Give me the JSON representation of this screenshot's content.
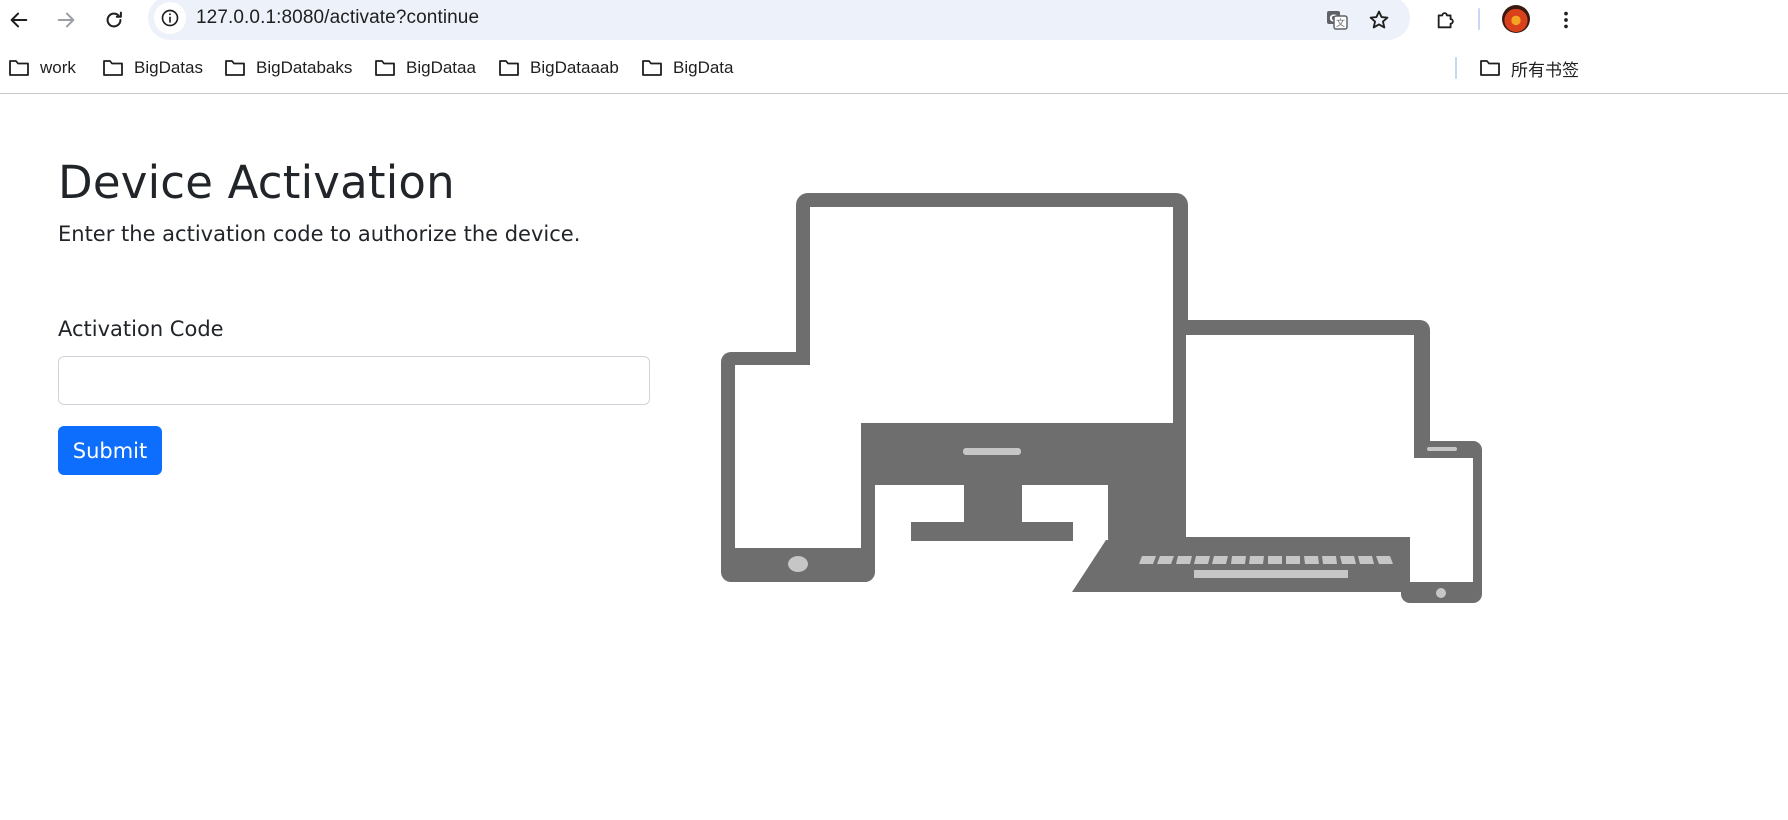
{
  "browser": {
    "url": "127.0.0.1:8080/activate?continue",
    "bookmarks": [
      "work",
      "BigDatas",
      "BigDatabaks",
      "BigDataa",
      "BigDataaab",
      "BigData"
    ],
    "all_bookmarks_label": "所有书签",
    "icons": {
      "back": "arrow-left-icon",
      "forward": "arrow-right-icon",
      "reload": "reload-icon",
      "site_info": "info-icon",
      "translate": "translate-icon",
      "bookmark": "star-icon",
      "extensions": "puzzle-icon",
      "menu": "kebab-menu-icon"
    }
  },
  "page": {
    "title": "Device Activation",
    "subtitle": "Enter the activation code to authorize the device.",
    "form": {
      "label": "Activation Code",
      "value": "",
      "placeholder": "",
      "submit_label": "Submit"
    },
    "illustration": "devices-illustration",
    "colors": {
      "primary": "#0d6efd",
      "illustration": "#6e6e6e",
      "text": "#212529"
    }
  }
}
